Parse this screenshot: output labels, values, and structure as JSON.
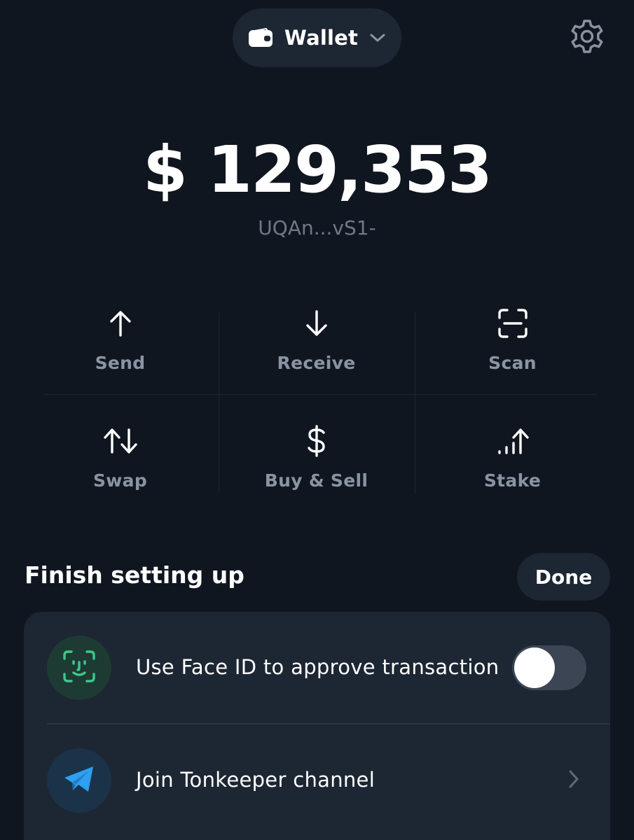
{
  "header": {
    "wallet_label": "Wallet",
    "wallet_icon": "wallet-icon",
    "settings_icon": "gear-icon"
  },
  "balance": {
    "amount": "$ 129,353",
    "address": "UQAn...vS1-"
  },
  "actions": [
    {
      "label": "Send",
      "icon": "arrow-up-icon"
    },
    {
      "label": "Receive",
      "icon": "arrow-down-icon"
    },
    {
      "label": "Scan",
      "icon": "scan-icon"
    },
    {
      "label": "Swap",
      "icon": "swap-icon"
    },
    {
      "label": "Buy & Sell",
      "icon": "dollar-icon"
    },
    {
      "label": "Stake",
      "icon": "stake-icon"
    }
  ],
  "setup": {
    "title": "Finish setting up",
    "done_label": "Done",
    "items": [
      {
        "text": "Use Face ID to approve transaction",
        "icon": "face-id-icon",
        "toggle_on": false
      },
      {
        "text": "Join Tonkeeper channel",
        "icon": "telegram-icon"
      }
    ]
  },
  "colors": {
    "background": "#10161f",
    "surface": "#1d2633",
    "secondary_text": "#8994a3",
    "face_id_green": "#3fc78c",
    "telegram_blue": "#2f9ff0"
  }
}
